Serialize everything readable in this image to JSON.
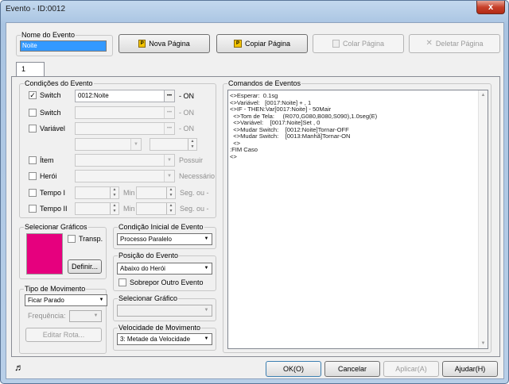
{
  "window": {
    "title": "Evento - ID:0012",
    "close_glyph": "x"
  },
  "event_name": {
    "label": "Nome do Evento",
    "value": "Noite"
  },
  "page_buttons": {
    "new": "Nova Página",
    "copy": "Copiar Página",
    "paste": "Colar Página",
    "delete": "Deletar Página"
  },
  "tabs": [
    "1"
  ],
  "conditions": {
    "label": "Condições do Evento",
    "switch1": {
      "label": "Switch",
      "checked": true,
      "value": "0012:Noite",
      "suffix": "- ON"
    },
    "switch2": {
      "label": "Switch",
      "checked": false,
      "value": "",
      "suffix": "- ON"
    },
    "variable": {
      "label": "Variável",
      "checked": false,
      "value": "",
      "suffix": "- ON"
    },
    "item": {
      "label": "Ítem",
      "checked": false,
      "suffix": "Possuir"
    },
    "hero": {
      "label": "Herói",
      "checked": false,
      "suffix": "Necessário"
    },
    "timer1": {
      "label": "Tempo I",
      "min": "Min",
      "sec": "Seg. ou -"
    },
    "timer2": {
      "label": "Tempo II",
      "min": "Min",
      "sec": "Seg. ou -"
    }
  },
  "graphics": {
    "label": "Selecionar Gráficos",
    "transp": "Transp.",
    "define": "Definir...",
    "swatch_color": "#e6007e"
  },
  "movement": {
    "label": "Tipo de Movimento",
    "value": "Ficar Parado",
    "frequency": "Frequência:",
    "edit_route": "Editar Rota..."
  },
  "start_condition": {
    "label": "Condição Inicial de Evento",
    "value": "Processo Paralelo"
  },
  "event_position": {
    "label": "Posição do Evento",
    "value": "Abaixo do Herói",
    "overlap": "Sobrepor Outro Evento"
  },
  "select_graphic": {
    "label": "Selecionar Gráfico",
    "value": ""
  },
  "move_speed": {
    "label": "Velocidade de Movimento",
    "value": "3: Metade da Velocidade"
  },
  "commands": {
    "label": "Comandos de Eventos",
    "lines": [
      "<>Esperar:  0.1sg",
      "<>Variável:   [0017:Noite] + , 1",
      "<>IF - THEN:Var[0017:Noite] - 50Mair",
      "  <>Tom de Tela:     (R070,G080,B080,S090),1.0seg(E)",
      "  <>Variável:    [0017:Noite]Set , 0",
      "  <>Mudar Switch:    [0012:Noite]Tornar-OFF",
      "  <>Mudar Switch:    [0013:Manhã]Tornar-ON",
      "  <>",
      ":FIM Caso",
      "<>"
    ]
  },
  "footer": {
    "ok": "OK(O)",
    "cancel": "Cancelar",
    "apply": "Aplicar(A)",
    "help": "Ajudar(H)"
  },
  "colors": {
    "accent": "#3399ff",
    "swatch": "#e6007e"
  }
}
